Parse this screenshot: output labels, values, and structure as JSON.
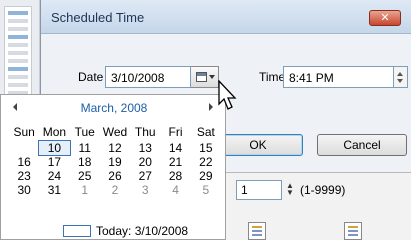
{
  "dialog": {
    "title": "Scheduled Time",
    "close_label": "✕",
    "date_label": "Date",
    "date_value": "3/10/2008",
    "time_label": "Time",
    "time_value": "8:41 PM",
    "ok_label": "OK",
    "cancel_label": "Cancel"
  },
  "calendar": {
    "month_label": "March, 2008",
    "weekdays": [
      "Sun",
      "Mon",
      "Tue",
      "Wed",
      "Thu",
      "Fri",
      "Sat"
    ],
    "weeks": [
      [
        "",
        "",
        "",
        "",
        "",
        "",
        ""
      ],
      [
        "",
        "",
        "",
        "",
        "",
        "",
        ""
      ],
      [
        "",
        "10",
        "11",
        "12",
        "13",
        "14",
        "15"
      ],
      [
        "16",
        "17",
        "18",
        "19",
        "20",
        "21",
        "22"
      ],
      [
        "23",
        "24",
        "25",
        "26",
        "27",
        "28",
        "29"
      ],
      [
        "30",
        "31",
        "1",
        "2",
        "3",
        "4",
        "5"
      ]
    ],
    "selected_day": "10",
    "muted_trailing_days": [
      "1",
      "2",
      "3",
      "4",
      "5"
    ],
    "today_label": "Today: 3/10/2008"
  },
  "background_panel": {
    "quantity_value": "1",
    "quantity_range": "(1-9999)"
  },
  "colors": {
    "accent": "#1e5fa8",
    "selection": "#3b73b9",
    "close_button": "#c7462e"
  }
}
